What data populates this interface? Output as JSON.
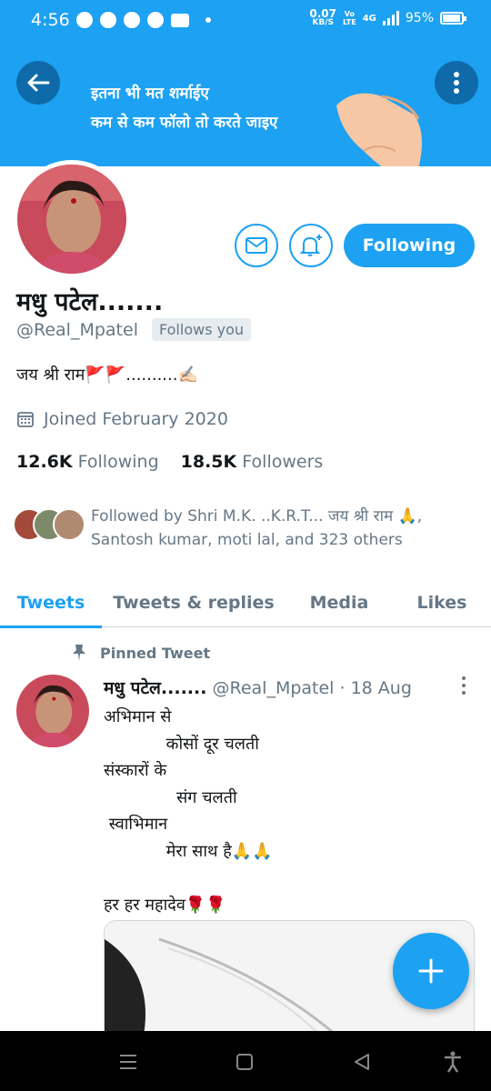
{
  "status_bar": {
    "time": "4:56",
    "net_speed_value": "0.07",
    "net_speed_unit": "KB/S",
    "volte_top": "Vo",
    "volte_bottom": "LTE",
    "network": "4G",
    "battery": "95%"
  },
  "banner": {
    "line1": "इतना भी मत शर्माईए",
    "line2": "कम से कम फॉलो तो करते जाइए"
  },
  "profile": {
    "name": "मधु पटेल.......",
    "handle": "@Real_Mpatel",
    "follows_you": "Follows you",
    "bio": "जय श्री राम🚩🚩..........✍🏻",
    "joined": "Joined February 2020",
    "following_count": "12.6K",
    "following_label": "Following",
    "followers_count": "18.5K",
    "followers_label": "Followers",
    "followed_by_line1": "Followed by Shri M.K. ..K.R.T... जय श्री राम 🙏,",
    "followed_by_line2": "Santosh kumar, moti lal, and 323 others",
    "follow_button": "Following"
  },
  "tabs": [
    "Tweets",
    "Tweets & replies",
    "Media",
    "Likes"
  ],
  "pinned_tweet": {
    "pinned_label": "Pinned Tweet",
    "author": "मधु पटेल.......",
    "handle": "@Real_Mpatel",
    "date": "· 18 Aug",
    "body": "अभिमान से\n            कोसों दूर चलती\nसंस्कारों के\n              संग चलती\n स्वाभिमान\n            मेरा साथ है🙏🙏\n\nहर हर महादेव🌹🌹"
  },
  "colors": {
    "accent": "#1da1f2",
    "muted": "#657786"
  }
}
